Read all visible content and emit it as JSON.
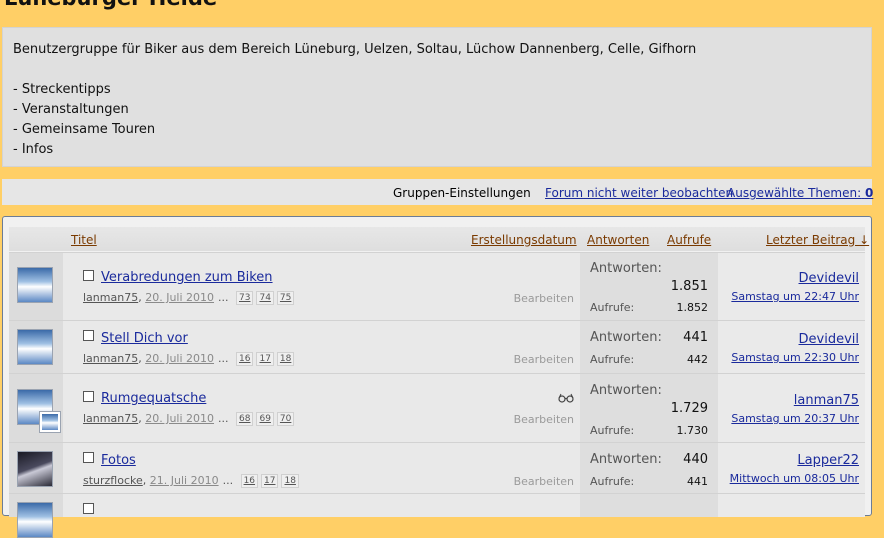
{
  "group": {
    "title": "Lüneburger Heide",
    "description": [
      "Benutzergruppe für Biker aus dem Bereich Lüneburg, Uelzen, Soltau, Lüchow Dannenberg, Celle, Gifhorn",
      "",
      "- Streckentipps",
      "- Veranstaltungen",
      "- Gemeinsame Touren",
      "- Infos"
    ]
  },
  "settings_bar": {
    "group_settings": "Gruppen-Einstellungen",
    "unwatch_forum": "Forum nicht weiter beobachten",
    "selected_threads_label": "Ausgewählte Themen:",
    "selected_threads_count": "0"
  },
  "columns": {
    "title": "Titel",
    "created": "Erstellungsdatum",
    "replies": "Antworten",
    "views": "Aufrufe",
    "last_post": "Letzter Beitrag ↓"
  },
  "labels": {
    "replies": "Antworten:",
    "views": "Aufrufe:",
    "edit": "Bearbeiten",
    "ellipsis": "..."
  },
  "threads": [
    {
      "title": "Verabredungen zum Biken",
      "author": "lanman75",
      "date": "20. Juli 2010",
      "pages": [
        "73",
        "74",
        "75"
      ],
      "replies": "1.851",
      "views": "1.852",
      "last_user": "Devidevil",
      "last_time": "Samstag um 22:47 Uhr",
      "avatar_icon": "user-avatar-icon"
    },
    {
      "title": "Stell Dich vor",
      "author": "lanman75",
      "date": "20. Juli 2010",
      "pages": [
        "16",
        "17",
        "18"
      ],
      "replies": "441",
      "views": "442",
      "last_user": "Devidevil",
      "last_time": "Samstag um 22:30 Uhr",
      "avatar_icon": "user-avatar-icon"
    },
    {
      "title": "Rumgequatsche",
      "author": "lanman75",
      "date": "20. Juli 2010",
      "pages": [
        "68",
        "69",
        "70"
      ],
      "replies": "1.729",
      "views": "1.730",
      "last_user": "lanman75",
      "last_time": "Samstag um 20:37 Uhr",
      "avatar_icon": "user-avatar-icon",
      "watched_icon": "glasses-icon"
    },
    {
      "title": "Fotos",
      "author": "sturzflocke",
      "date": "21. Juli 2010",
      "pages": [
        "16",
        "17",
        "18"
      ],
      "replies": "440",
      "views": "441",
      "last_user": "Lapper22",
      "last_time": "Mittwoch um 08:05 Uhr",
      "avatar_icon": "user-avatar-icon"
    }
  ]
}
